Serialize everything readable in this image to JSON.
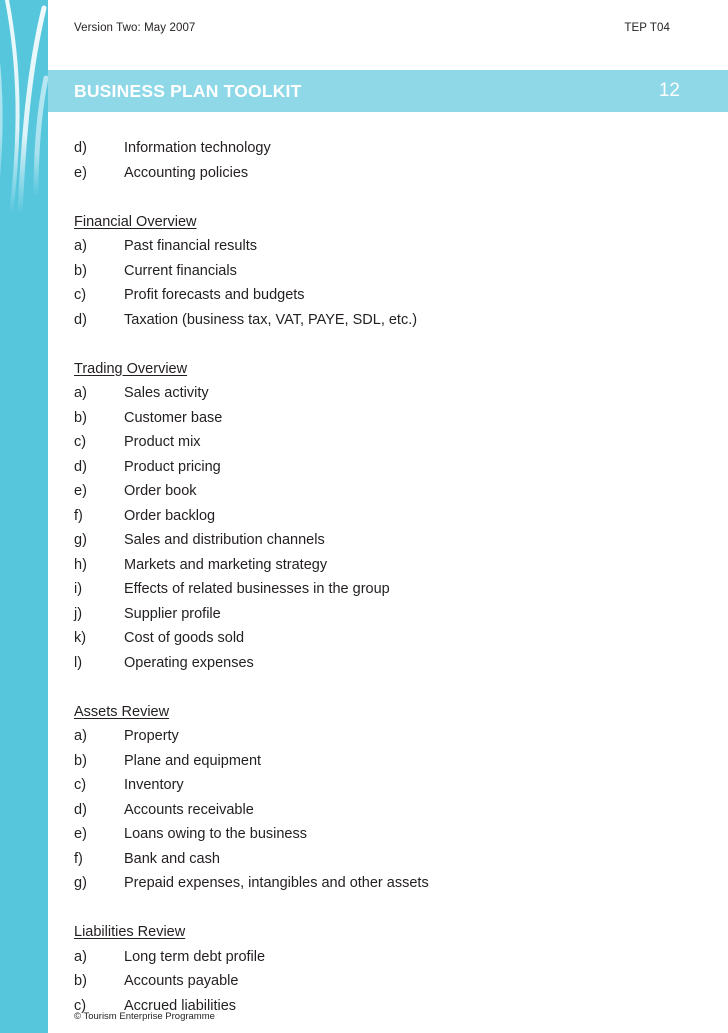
{
  "colors": {
    "strip": "#56c6dd",
    "band": "#8ed8e7",
    "band_text": "#ffffff",
    "body_text": "#231f20",
    "arc_light": "#c9ecf5",
    "arc_white": "#e8f7fb"
  },
  "running_head": {
    "left": "Version Two: May 2007",
    "right": "TEP T04"
  },
  "title_band": {
    "title": "BUSINESS PLAN TOOLKIT",
    "page_number": "12"
  },
  "content": {
    "blocks": [
      {
        "heading": null,
        "items": [
          {
            "label": "d)",
            "text": "Information technology"
          },
          {
            "label": "e)",
            "text": "Accounting policies"
          }
        ]
      },
      {
        "heading": "Financial Overview",
        "items": [
          {
            "label": "a)",
            "text": "Past financial results"
          },
          {
            "label": "b)",
            "text": "Current financials"
          },
          {
            "label": "c)",
            "text": "Profit forecasts and budgets"
          },
          {
            "label": "d)",
            "text": "Taxation (business tax, VAT, PAYE, SDL, etc.)"
          }
        ]
      },
      {
        "heading": "Trading Overview",
        "items": [
          {
            "label": "a)",
            "text": "Sales activity"
          },
          {
            "label": "b)",
            "text": "Customer base"
          },
          {
            "label": "c)",
            "text": "Product mix"
          },
          {
            "label": "d)",
            "text": "Product pricing"
          },
          {
            "label": "e)",
            "text": "Order book"
          },
          {
            "label": "f)",
            "text": "Order backlog"
          },
          {
            "label": "g)",
            "text": "Sales and distribution channels"
          },
          {
            "label": "h)",
            "text": "Markets and marketing strategy"
          },
          {
            "label": "i)",
            "text": "Effects of related businesses in the group"
          },
          {
            "label": "j)",
            "text": "Supplier profile"
          },
          {
            "label": "k)",
            "text": "Cost of goods sold"
          },
          {
            "label": "l)",
            "text": "Operating expenses"
          }
        ]
      },
      {
        "heading": "Assets Review",
        "items": [
          {
            "label": "a)",
            "text": "Property"
          },
          {
            "label": "b)",
            "text": "Plane and equipment"
          },
          {
            "label": "c)",
            "text": "Inventory"
          },
          {
            "label": "d)",
            "text": "Accounts receivable"
          },
          {
            "label": "e)",
            "text": "Loans owing to the business"
          },
          {
            "label": "f)",
            "text": "Bank and cash"
          },
          {
            "label": "g)",
            "text": "Prepaid expenses, intangibles and other assets"
          }
        ]
      },
      {
        "heading": "Liabilities Review",
        "items": [
          {
            "label": "a)",
            "text": "Long term debt profile"
          },
          {
            "label": "b)",
            "text": "Accounts payable"
          },
          {
            "label": "c)",
            "text": "Accrued liabilities"
          }
        ]
      }
    ]
  },
  "footer": {
    "copyright": "© Tourism Enterprise Programme"
  }
}
